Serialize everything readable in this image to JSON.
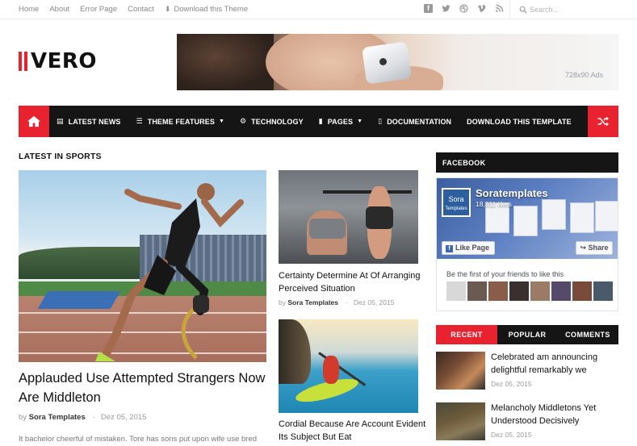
{
  "topbar": {
    "menu": [
      "Home",
      "About",
      "Error Page",
      "Contact",
      "Download this Theme"
    ],
    "social_icons": [
      "facebook-icon",
      "twitter-icon",
      "dribbble-icon",
      "vimeo-icon",
      "rss-icon"
    ],
    "search_placeholder": "Search..."
  },
  "logo": {
    "text": "VERO"
  },
  "ad": {
    "label": "728x90 Ads"
  },
  "nav": {
    "items": [
      {
        "label": "LATEST NEWS",
        "icon": "newspaper-icon"
      },
      {
        "label": "THEME FEATURES",
        "icon": "sliders-icon",
        "dropdown": true
      },
      {
        "label": "TECHNOLOGY",
        "icon": "gears-icon"
      },
      {
        "label": "PAGES",
        "icon": "bookmark-icon",
        "dropdown": true
      },
      {
        "label": "DOCUMENTATION",
        "icon": "file-icon"
      },
      {
        "label": "DOWNLOAD THIS TEMPLATE",
        "icon": ""
      }
    ],
    "colors": {
      "accent": "#e8222f",
      "bar": "#151515"
    }
  },
  "section": {
    "title": "LATEST IN SPORTS"
  },
  "main_post": {
    "title": "Applauded Use Attempted Strangers Now Are Middleton",
    "author": "Sora Templates",
    "date": "Dez 05, 2015",
    "excerpt": "It bachelor cheerful of mistaken. Tore has sons put upon wife use bred"
  },
  "mid_posts": [
    {
      "title": "Certainty Determine At Of Arranging Perceived Situation",
      "author": "Sora Templates",
      "date": "Dez 05, 2015"
    },
    {
      "title": "Cordial Because Are Account Evident Its Subject But Eat"
    }
  ],
  "sidebar": {
    "facebook_title": "FACEBOOK",
    "fb": {
      "page_name": "Soratemplates",
      "likes": "18,811 likes",
      "logo_text": "Sora",
      "logo_sub": "Templates",
      "like_label": "Like Page",
      "share_label": "Share",
      "friends_text": "Be the first of your friends to like this"
    },
    "tabs": [
      {
        "label": "RECENT",
        "active": true
      },
      {
        "label": "POPULAR",
        "active": false
      },
      {
        "label": "COMMENTS",
        "active": false
      }
    ],
    "recent": [
      {
        "title": "Celebrated am announcing delightful remarkably we",
        "date": "Dez 05, 2015"
      },
      {
        "title": "Melancholy Middletons Yet Understood Decisively",
        "date": "Dez 05, 2015"
      }
    ]
  }
}
